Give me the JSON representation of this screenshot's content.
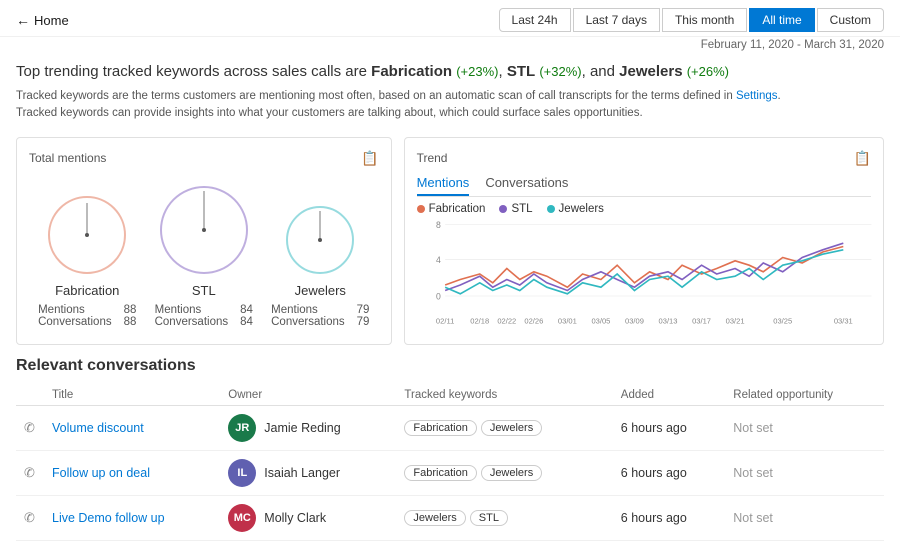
{
  "topbar": {
    "back_label": "Home"
  },
  "time_filters": [
    {
      "id": "last24h",
      "label": "Last 24h",
      "active": false
    },
    {
      "id": "last7d",
      "label": "Last 7 days",
      "active": false
    },
    {
      "id": "thismonth",
      "label": "This month",
      "active": false
    },
    {
      "id": "alltime",
      "label": "All time",
      "active": true
    },
    {
      "id": "custom",
      "label": "Custom",
      "active": false
    }
  ],
  "date_range": "February 11, 2020 - March 31, 2020",
  "headline": {
    "prefix": "Top trending tracked keywords across sales calls are ",
    "k1": "Fabrication",
    "k1_change": "(+23%)",
    "k2": "STL",
    "k2_change": "(+32%)",
    "k3": "Jewelers",
    "k3_change": "(+26%)"
  },
  "description_line1": "Tracked keywords are the terms customers are mentioning most often, based on an automatic scan of call transcripts for the terms defined in ",
  "settings_link": "Settings",
  "description_line2": "Tracked keywords can provide insights into what your customers are talking about, which could surface sales opportunities.",
  "total_mentions": {
    "title": "Total mentions",
    "keywords": [
      {
        "name": "Fabrication",
        "color": "#e07050",
        "radius": 40,
        "mentions": 88,
        "conversations": 88
      },
      {
        "name": "STL",
        "color": "#8060c0",
        "radius": 45,
        "mentions": 84,
        "conversations": 84
      },
      {
        "name": "Jewelers",
        "color": "#30b8c0",
        "radius": 35,
        "mentions": 79,
        "conversations": 79
      }
    ],
    "labels": {
      "mentions": "Mentions",
      "conversations": "Conversations"
    }
  },
  "trend": {
    "title": "Trend",
    "tabs": [
      "Mentions",
      "Conversations"
    ],
    "active_tab": "Mentions",
    "legend": [
      {
        "label": "Fabrication",
        "color": "#e07050"
      },
      {
        "label": "STL",
        "color": "#8060c0"
      },
      {
        "label": "Jewelers",
        "color": "#30b8c0"
      }
    ],
    "y_labels": [
      "8",
      "4",
      "0"
    ],
    "x_labels": [
      "02/11",
      "02/18",
      "02/22",
      "02/26",
      "03/01",
      "03/05",
      "03/09",
      "03/13",
      "03/17",
      "03/21",
      "03/25",
      "03/31"
    ]
  },
  "relevant_conversations": {
    "title": "Relevant conversations",
    "columns": [
      "",
      "Title",
      "Owner",
      "Tracked keywords",
      "Added",
      "Related opportunity"
    ],
    "rows": [
      {
        "icon": "phone",
        "title": "Volume discount",
        "owner_initials": "JR",
        "owner_name": "Jamie Reding",
        "owner_color": "#1a7a4a",
        "keywords": [
          "Fabrication",
          "Jewelers"
        ],
        "added": "6 hours ago",
        "related": "Not set"
      },
      {
        "icon": "phone",
        "title": "Follow up on deal",
        "owner_initials": "IL",
        "owner_name": "Isaiah Langer",
        "owner_color": "#6060b0",
        "keywords": [
          "Fabrication",
          "Jewelers"
        ],
        "added": "6 hours ago",
        "related": "Not set"
      },
      {
        "icon": "phone",
        "title": "Live Demo follow up",
        "owner_initials": "MC",
        "owner_name": "Molly Clark",
        "owner_color": "#c0304a",
        "keywords": [
          "Jewelers",
          "STL"
        ],
        "added": "6 hours ago",
        "related": "Not set"
      }
    ]
  }
}
